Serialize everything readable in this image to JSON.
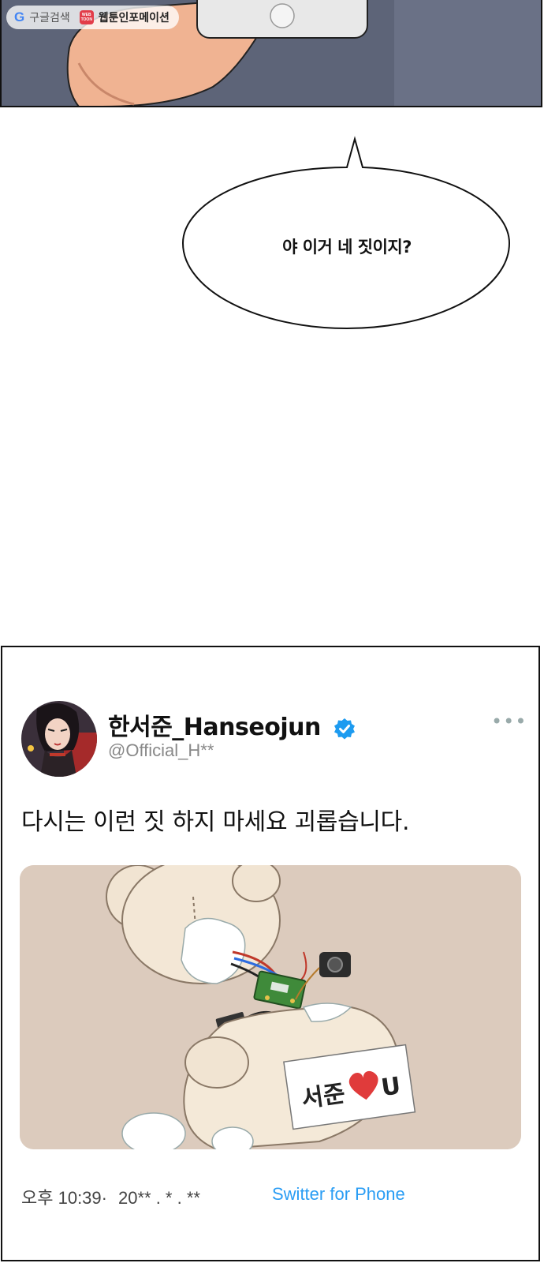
{
  "watermark": {
    "search_label": "구글검색",
    "badge_lines": [
      "WEB",
      "TOON"
    ],
    "site_label": "웹툰인포메이션"
  },
  "speech_bubble": {
    "text": "야 이거 네 짓이지?"
  },
  "tweet": {
    "display_name": "한서준_Hanseojun",
    "handle": "@Official_H**",
    "more_icon": "more-dots-icon",
    "verified_icon": "verified-check-icon",
    "text": "다시는 이런 짓 하지 마세요 괴롭습니다.",
    "media": {
      "card_text": "서준",
      "card_suffix": "U",
      "heart_color": "#e03b3b"
    },
    "time": "오후 10:39·",
    "date": "20** . * . **",
    "source": "Switter for Phone"
  },
  "colors": {
    "link": "#2a9df4",
    "verified": "#1d9bf0",
    "panel_bg": "#5d6478"
  }
}
